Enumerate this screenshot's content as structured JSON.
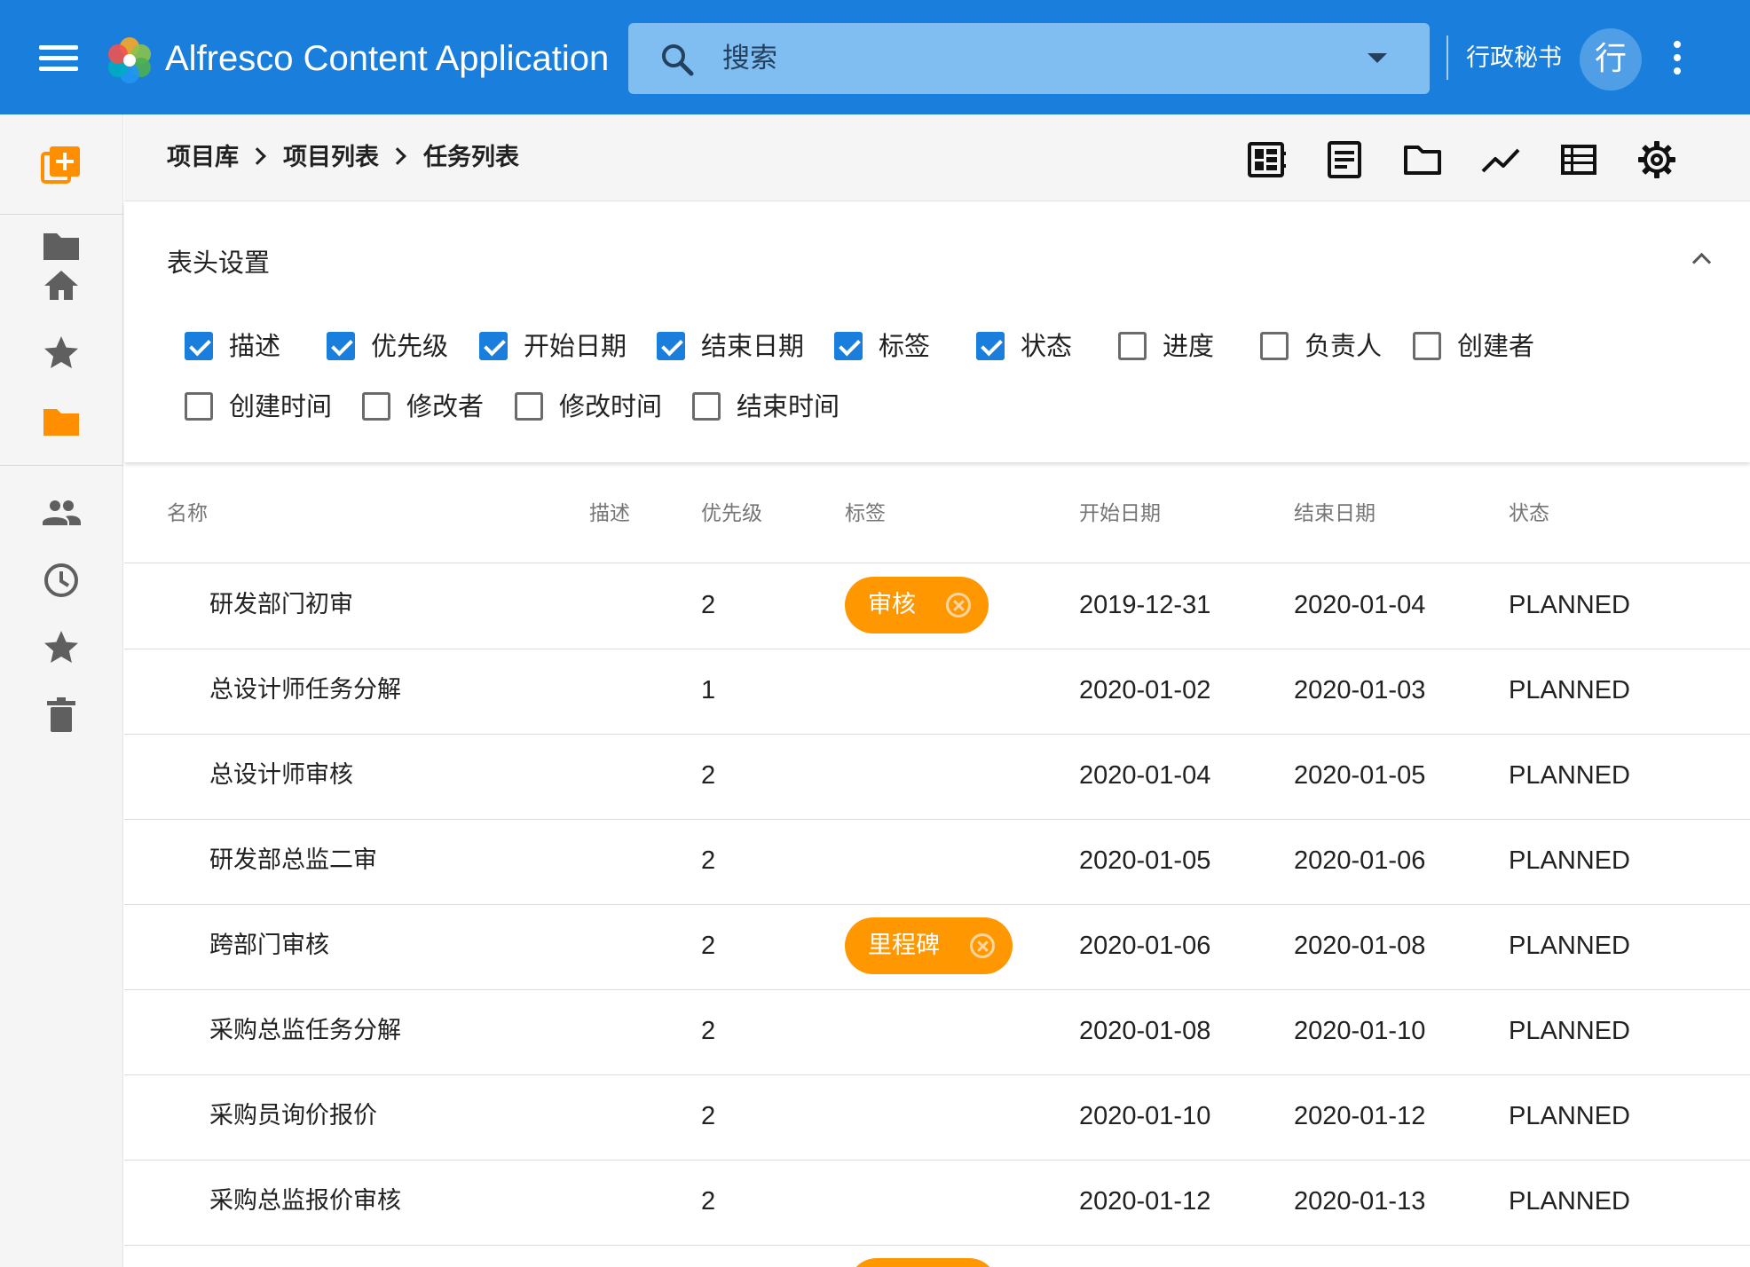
{
  "app": {
    "title": "Alfresco Content Application",
    "search_placeholder": "搜索",
    "user_name": "行政秘书",
    "user_initial": "行",
    "brand_color": "#1a7fdc",
    "accent_color": "#ff9800"
  },
  "sidebar": {
    "items": [
      {
        "icon": "create-icon"
      },
      {
        "icon": "folder-icon"
      },
      {
        "icon": "home-icon"
      },
      {
        "icon": "star-icon"
      },
      {
        "icon": "folder-active-icon"
      },
      {
        "icon": "people-icon"
      },
      {
        "icon": "clock-icon"
      },
      {
        "icon": "favorite-star-icon"
      },
      {
        "icon": "trash-icon"
      }
    ]
  },
  "breadcrumb": [
    "项目库",
    "项目列表",
    "任务列表"
  ],
  "toolbar": {
    "icons": [
      "dashboard-icon",
      "document-icon",
      "folder-outline-icon",
      "trend-icon",
      "list-icon",
      "settings-icon"
    ]
  },
  "column_settings": {
    "title": "表头设置",
    "options": [
      {
        "label": "描述",
        "checked": true
      },
      {
        "label": "优先级",
        "checked": true
      },
      {
        "label": "开始日期",
        "checked": true
      },
      {
        "label": "结束日期",
        "checked": true
      },
      {
        "label": "标签",
        "checked": true
      },
      {
        "label": "状态",
        "checked": true
      },
      {
        "label": "进度",
        "checked": false
      },
      {
        "label": "负责人",
        "checked": false
      },
      {
        "label": "创建者",
        "checked": false
      },
      {
        "label": "创建时间",
        "checked": false
      },
      {
        "label": "修改者",
        "checked": false
      },
      {
        "label": "修改时间",
        "checked": false
      },
      {
        "label": "结束时间",
        "checked": false
      }
    ]
  },
  "table": {
    "headers": [
      "名称",
      "描述",
      "优先级",
      "标签",
      "开始日期",
      "结束日期",
      "状态"
    ],
    "rows": [
      {
        "name": "研发部门初审",
        "desc": "",
        "priority": "2",
        "tag": "审核",
        "start": "2019-12-31",
        "end": "2020-01-04",
        "status": "PLANNED"
      },
      {
        "name": "总设计师任务分解",
        "desc": "",
        "priority": "1",
        "tag": "",
        "start": "2020-01-02",
        "end": "2020-01-03",
        "status": "PLANNED"
      },
      {
        "name": "总设计师审核",
        "desc": "",
        "priority": "2",
        "tag": "",
        "start": "2020-01-04",
        "end": "2020-01-05",
        "status": "PLANNED"
      },
      {
        "name": "研发部总监二审",
        "desc": "",
        "priority": "2",
        "tag": "",
        "start": "2020-01-05",
        "end": "2020-01-06",
        "status": "PLANNED"
      },
      {
        "name": "跨部门审核",
        "desc": "",
        "priority": "2",
        "tag": "里程碑",
        "start": "2020-01-06",
        "end": "2020-01-08",
        "status": "PLANNED"
      },
      {
        "name": "采购总监任务分解",
        "desc": "",
        "priority": "2",
        "tag": "",
        "start": "2020-01-08",
        "end": "2020-01-10",
        "status": "PLANNED"
      },
      {
        "name": "采购员询价报价",
        "desc": "",
        "priority": "2",
        "tag": "",
        "start": "2020-01-10",
        "end": "2020-01-12",
        "status": "PLANNED"
      },
      {
        "name": "采购总监报价审核",
        "desc": "",
        "priority": "2",
        "tag": "",
        "start": "2020-01-12",
        "end": "2020-01-13",
        "status": "PLANNED"
      }
    ]
  }
}
